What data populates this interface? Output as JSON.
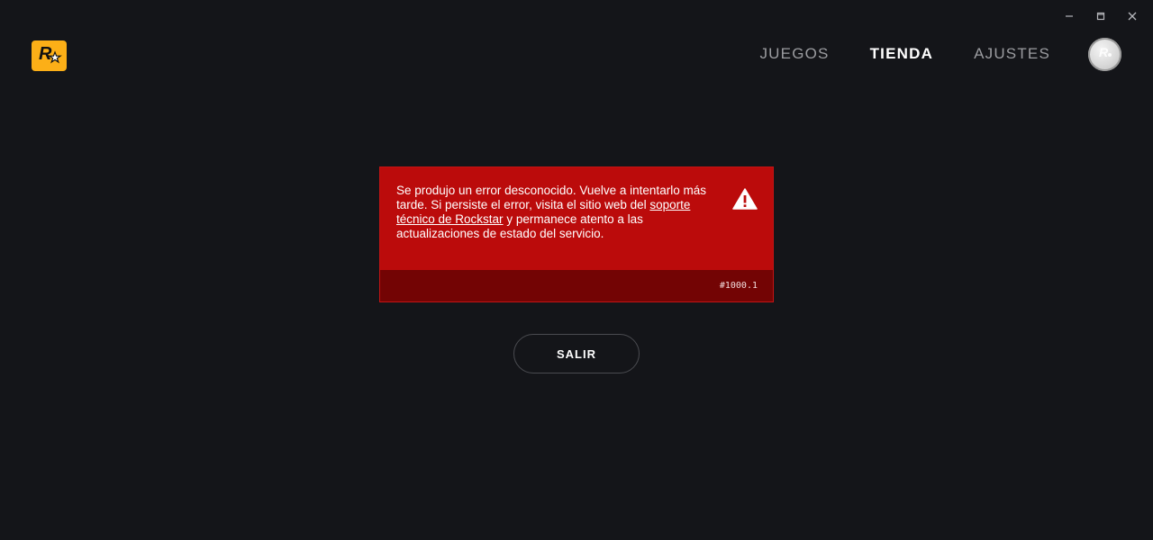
{
  "window_controls": {
    "minimize_icon": "minimize-icon",
    "maximize_icon": "maximize-icon",
    "close_icon": "close-icon"
  },
  "logo": {
    "icon": "rockstar-logo-icon",
    "color": "#fcaf17"
  },
  "nav": {
    "items": [
      {
        "label": "JUEGOS",
        "active": false
      },
      {
        "label": "TIENDA",
        "active": true
      },
      {
        "label": "AJUSTES",
        "active": false
      }
    ]
  },
  "avatar": {
    "icon": "profile-avatar-icon"
  },
  "error": {
    "text_before_link": "Se produjo un error desconocido. Vuelve a intentarlo más tarde. Si persiste el error, visita el sitio web del ",
    "link_text": "soporte técnico de Rockstar",
    "text_after_link": " y permanece atento a las actualizaciones de estado del servicio.",
    "icon": "warning-icon",
    "code": "#1000.1",
    "background_color": "#bb0b0b",
    "footer_color": "#730404"
  },
  "exit_button": {
    "label": "SALIR"
  }
}
